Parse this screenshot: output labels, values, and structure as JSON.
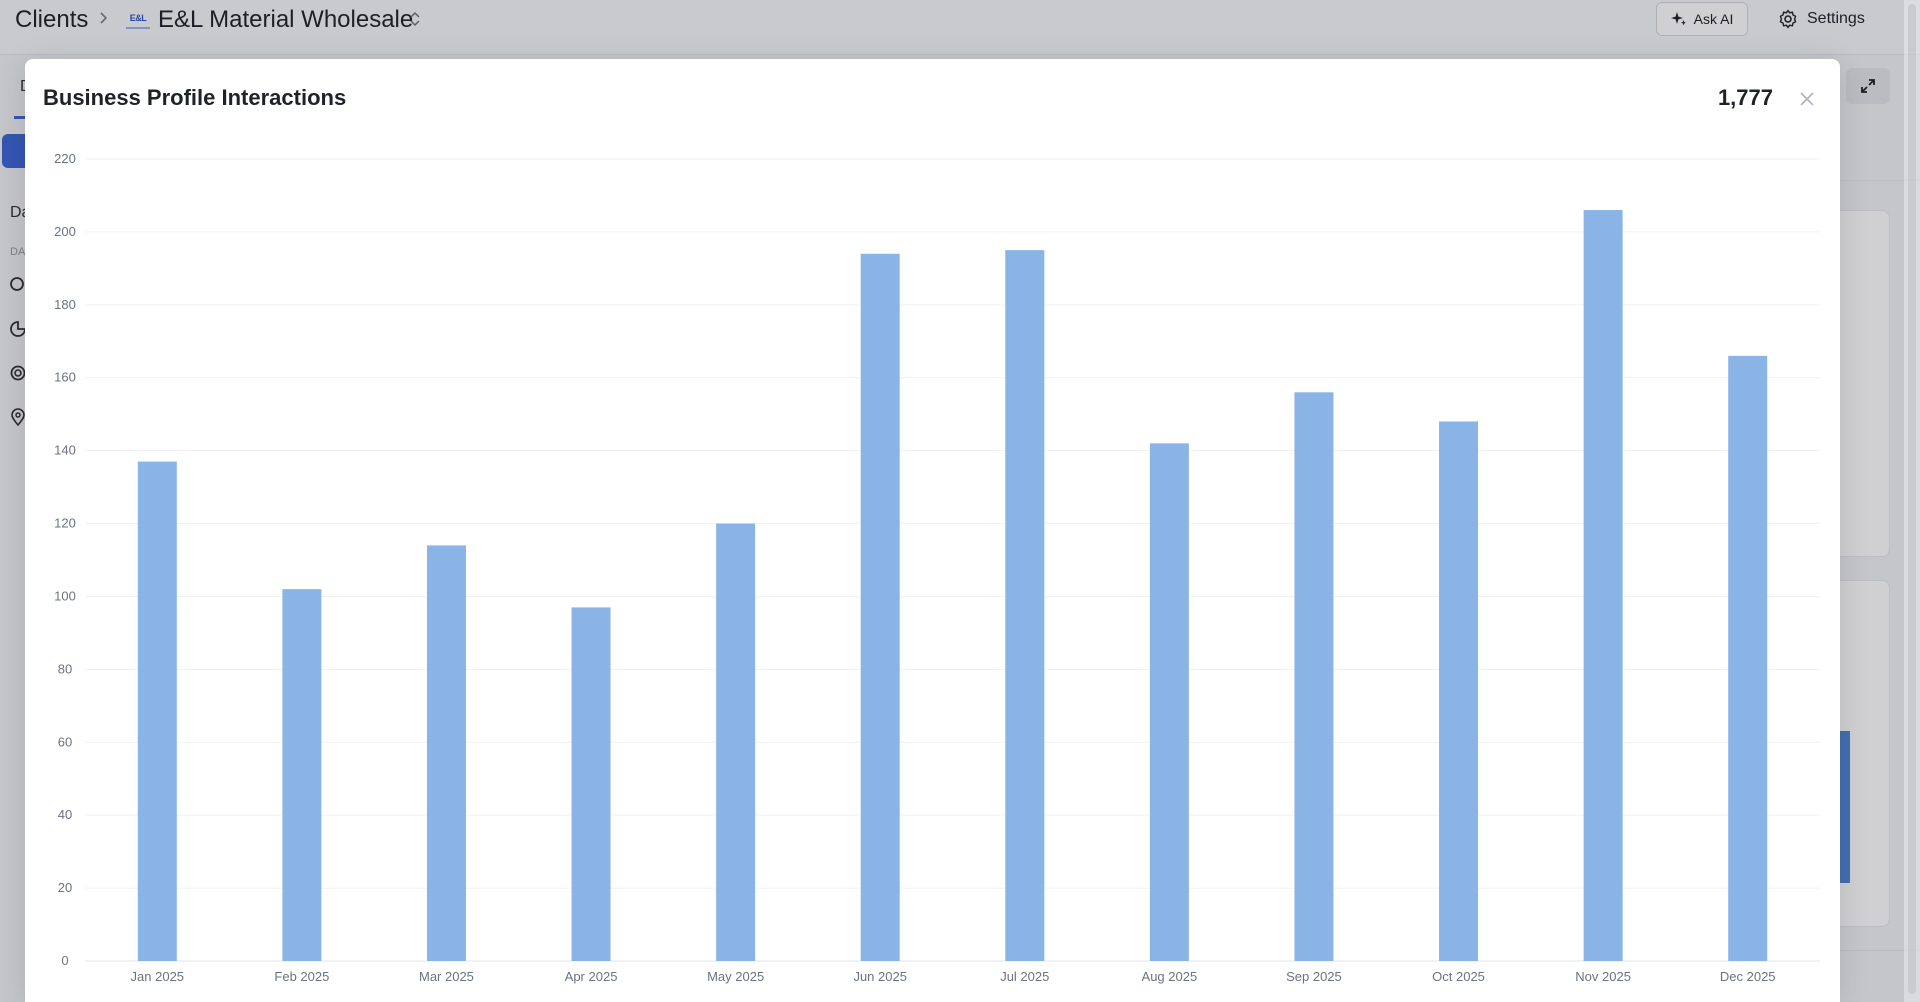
{
  "header": {
    "breadcrumb_root": "Clients",
    "client_logo_text": "E&L",
    "client_name": "E&L Material Wholesale",
    "ask_ai_label": "Ask AI",
    "settings_label": "Settings"
  },
  "background": {
    "tab_letter": "D",
    "side_text": "Da",
    "side_subtext": "DA"
  },
  "modal": {
    "title": "Business Profile Interactions",
    "total": "1,777"
  },
  "colors": {
    "bar": "#8ab4e6",
    "accent": "#3d66d9"
  },
  "chart_data": {
    "type": "bar",
    "categories": [
      "Jan 2025",
      "Feb 2025",
      "Mar 2025",
      "Apr 2025",
      "May 2025",
      "Jun 2025",
      "Jul 2025",
      "Aug 2025",
      "Sep 2025",
      "Oct 2025",
      "Nov 2025",
      "Dec 2025"
    ],
    "values": [
      137,
      102,
      114,
      97,
      120,
      194,
      195,
      142,
      156,
      148,
      206,
      166
    ],
    "ylim": [
      0,
      220
    ],
    "yticks": [
      0,
      20,
      40,
      60,
      80,
      100,
      120,
      140,
      160,
      180,
      200,
      220
    ],
    "grid": true,
    "legend": "none"
  }
}
